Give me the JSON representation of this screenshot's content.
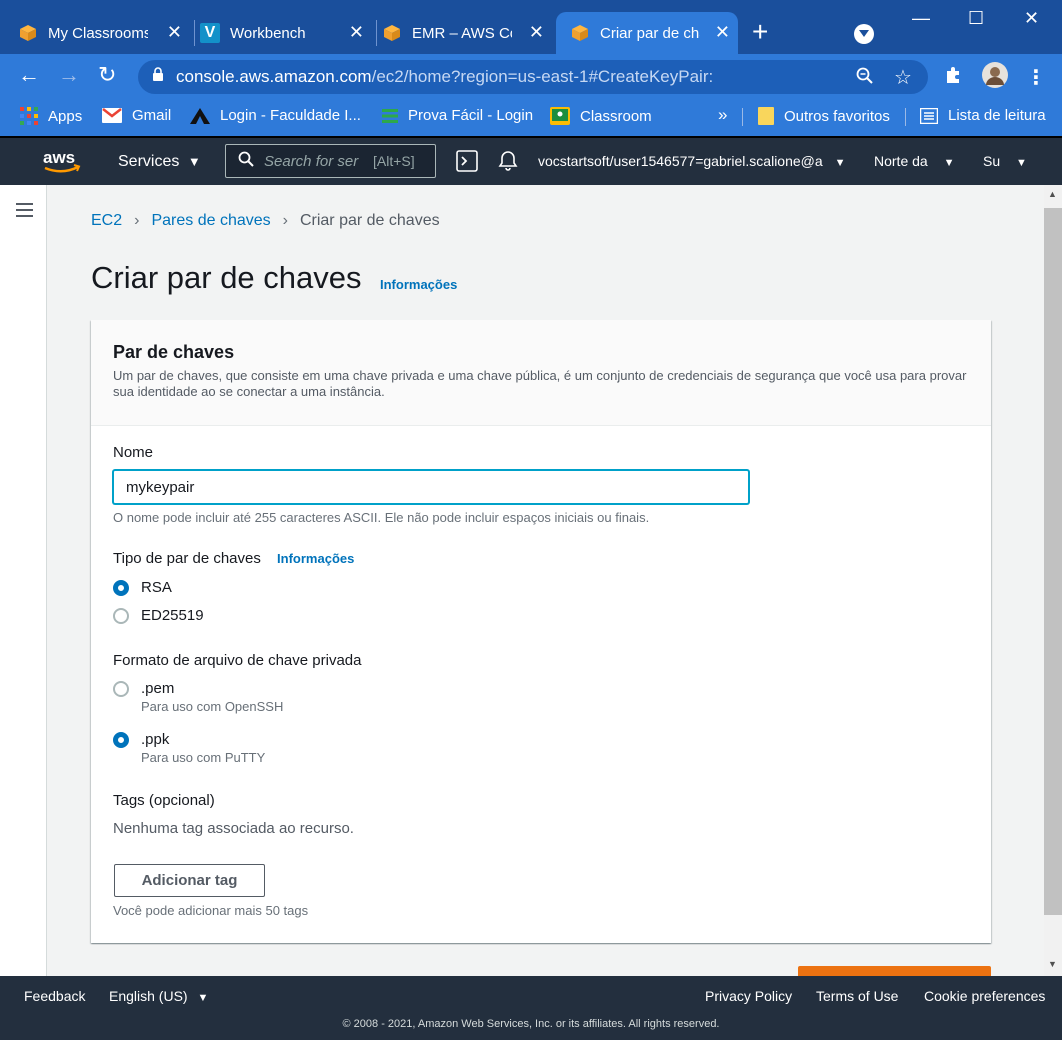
{
  "browser": {
    "tabs": [
      {
        "title": "My Classrooms",
        "icon": "aws-cube-icon"
      },
      {
        "title": "Workbench",
        "icon": "vocareum-icon"
      },
      {
        "title": "EMR – AWS Con",
        "icon": "aws-cube-icon"
      },
      {
        "title": "Criar par de cha",
        "icon": "aws-cube-icon",
        "active": true
      }
    ],
    "url_host": "console.aws.amazon.com",
    "url_path": "/ec2/home?region=us-east-1#CreateKeyPair:",
    "bookmarks": {
      "apps": "Apps",
      "gmail": "Gmail",
      "login_faculdade": "Login - Faculdade I...",
      "prova_facil": "Prova Fácil - Login",
      "classroom": "Classroom",
      "more": "»",
      "outros": "Outros favoritos",
      "lista": "Lista de leitura"
    }
  },
  "aws_nav": {
    "logo": "aws",
    "services": "Services",
    "search_placeholder": "Search for services",
    "search_shortcut": "[Alt+S]",
    "account": "vocstartsoft/user1546577=gabriel.scalione@a",
    "region": "Norte da",
    "support": "Su"
  },
  "breadcrumb": {
    "ec2": "EC2",
    "pares": "Pares de chaves",
    "current": "Criar par de chaves"
  },
  "page": {
    "title": "Criar par de chaves",
    "info": "Informações"
  },
  "panel": {
    "title": "Par de chaves",
    "description": "Um par de chaves, que consiste em uma chave privada e uma chave pública, é um conjunto de credenciais de segurança que você usa para provar sua identidade ao se conectar a uma instância.",
    "name_label": "Nome",
    "name_value": "mykeypair",
    "name_hint": "O nome pode incluir até 255 caracteres ASCII. Ele não pode incluir espaços iniciais ou finais.",
    "type_label": "Tipo de par de chaves",
    "type_info": "Informações",
    "type_options": [
      {
        "label": "RSA",
        "selected": true
      },
      {
        "label": "ED25519",
        "selected": false
      }
    ],
    "format_label": "Formato de arquivo de chave privada",
    "format_options": [
      {
        "label": ".pem",
        "sub": "Para uso com OpenSSH",
        "selected": false
      },
      {
        "label": ".ppk",
        "sub": "Para uso com PuTTY",
        "selected": true
      }
    ],
    "tags_label": "Tags (opcional)",
    "tags_empty": "Nenhuma tag associada ao recurso.",
    "add_tag_button": "Adicionar tag",
    "tags_hint": "Você pode adicionar mais 50 tags"
  },
  "footer": {
    "feedback": "Feedback",
    "language": "English (US)",
    "privacy": "Privacy Policy",
    "terms": "Terms of Use",
    "cookies": "Cookie preferences",
    "copyright": "© 2008 - 2021, Amazon Web Services, Inc. or its affiliates. All rights reserved."
  },
  "colors": {
    "aws_nav": "#232f3e",
    "link": "#0073bb",
    "primary_button": "#ec7211",
    "browser_tabbar": "#1a4f9c",
    "browser_toolbar": "#2f7ad9"
  }
}
